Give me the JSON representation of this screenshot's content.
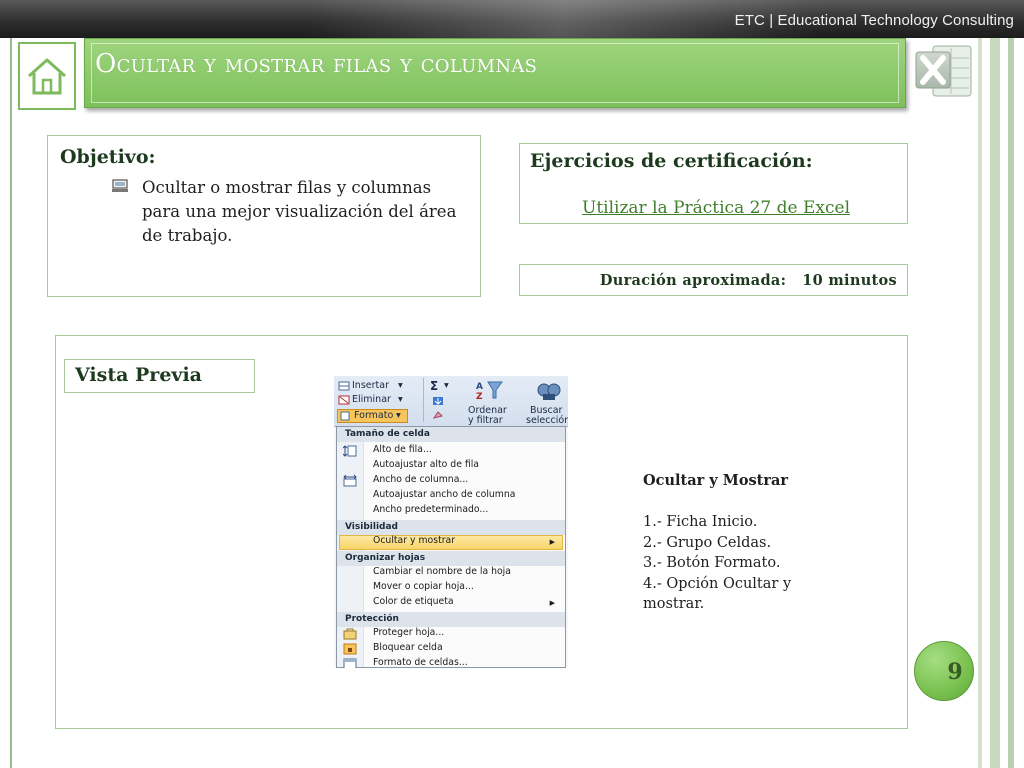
{
  "header": {
    "brand": "ETC | Educational Technology Consulting",
    "title": "Ocultar y mostrar filas y columnas",
    "home_icon": "home-icon",
    "logo_icon": "excel-logo-icon"
  },
  "objetivo": {
    "heading": "Objetivo:",
    "text": "Ocultar o mostrar filas y columnas para una mejor visualización del área de trabajo.",
    "bullet_icon": "computer-bullet-icon"
  },
  "ejercicios": {
    "heading": "Ejercicios de  certificación:",
    "link": "Utilizar la Práctica 27 de Excel"
  },
  "duracion": {
    "text": "Duración aproximada:   10 minutos"
  },
  "preview": {
    "heading": "Vista Previa",
    "ribbon": {
      "insertar": "Insertar",
      "eliminar": "Eliminar",
      "formato": "Formato",
      "sigma": "Σ",
      "ordenar": "Ordenar",
      "filtrar": "y filtrar",
      "buscar": "Buscar",
      "seleccion": "selección"
    },
    "menu": {
      "sections": [
        "Tamaño de celda",
        "Visibilidad",
        "Organizar hojas",
        "Protección"
      ],
      "items": [
        "Alto de fila...",
        "Autoajustar alto de fila",
        "Ancho de columna...",
        "Autoajustar ancho de columna",
        "Ancho predeterminado...",
        "Ocultar y mostrar",
        "Cambiar el nombre de la hoja",
        "Mover o copiar hoja...",
        "Color de etiqueta",
        "Proteger hoja...",
        "Bloquear celda",
        "Formato de celdas..."
      ]
    },
    "steps_title": "Ocultar y Mostrar",
    "steps": [
      "1.- Ficha Inicio.",
      "2.- Grupo Celdas.",
      "3.- Botón Formato.",
      "4.- Opción Ocultar y mostrar."
    ]
  },
  "page_number": "9",
  "colors": {
    "accent_green": "#7dc05a",
    "border_green": "#a7c99b",
    "text_dark": "#1e3a1e"
  }
}
